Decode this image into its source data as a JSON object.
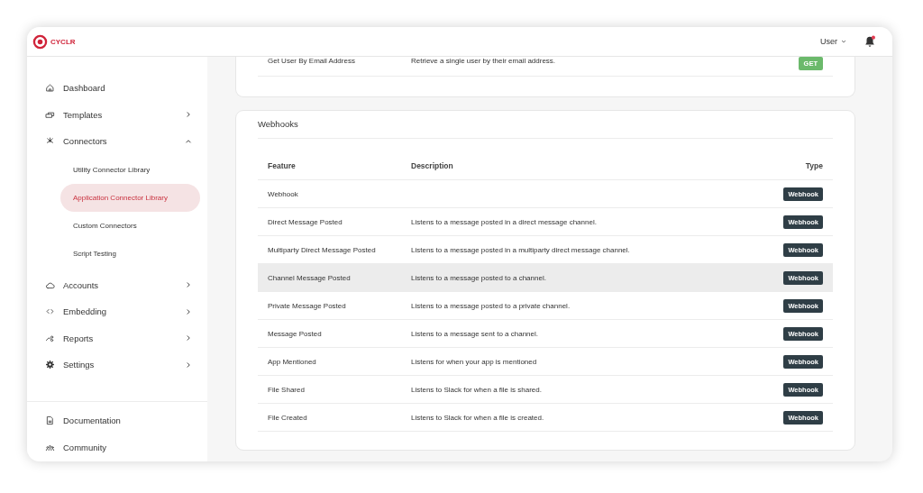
{
  "header": {
    "logo": "CYCLR",
    "user_menu": "User",
    "notifications": true
  },
  "sidebar": {
    "items": [
      {
        "label": "Dashboard"
      },
      {
        "label": "Templates",
        "expanded": false
      },
      {
        "label": "Connectors",
        "expanded": true,
        "children": [
          {
            "label": "Utility Connector Library",
            "selected": false
          },
          {
            "label": "Application Connector Library",
            "selected": true
          },
          {
            "label": "Custom Connectors",
            "selected": false
          },
          {
            "label": "Script Testing",
            "selected": false
          }
        ]
      },
      {
        "label": "Accounts",
        "expanded": false
      },
      {
        "label": "Embedding",
        "expanded": false
      },
      {
        "label": "Reports",
        "expanded": false
      },
      {
        "label": "Settings",
        "expanded": false
      }
    ],
    "footer_items": [
      {
        "label": "Documentation"
      },
      {
        "label": "Community"
      }
    ]
  },
  "actions_card": {
    "rows": [
      {
        "feature": "Get User By Email Address",
        "description": "Retrieve a single user by their email address.",
        "type": "GET",
        "kind": "get"
      }
    ]
  },
  "webhooks_card": {
    "title": "Webhooks",
    "columns": [
      "Feature",
      "Description",
      "Type"
    ],
    "rows": [
      {
        "feature": "Webhook",
        "description": "",
        "type": "Webhook",
        "kind": "webhook",
        "highlighted": false
      },
      {
        "feature": "Direct Message Posted",
        "description": "Listens to a message posted in a direct message channel.",
        "type": "Webhook",
        "kind": "webhook",
        "highlighted": false
      },
      {
        "feature": "Multiparty Direct Message Posted",
        "description": "Listens to a message posted in a multiparty direct message channel.",
        "type": "Webhook",
        "kind": "webhook",
        "highlighted": false
      },
      {
        "feature": "Channel Message Posted",
        "description": "Listens to a message posted to a channel.",
        "type": "Webhook",
        "kind": "webhook",
        "highlighted": true
      },
      {
        "feature": "Private Message Posted",
        "description": "Listens to a message posted to a private channel.",
        "type": "Webhook",
        "kind": "webhook",
        "highlighted": false
      },
      {
        "feature": "Message Posted",
        "description": "Listens to a message sent to a channel.",
        "type": "Webhook",
        "kind": "webhook",
        "highlighted": false
      },
      {
        "feature": "App Mentioned",
        "description": "Listens for when your app is mentioned",
        "type": "Webhook",
        "kind": "webhook",
        "highlighted": false
      },
      {
        "feature": "File Shared",
        "description": "Listens to Slack for when a file is shared.",
        "type": "Webhook",
        "kind": "webhook",
        "highlighted": false
      },
      {
        "feature": "File Created",
        "description": "Listens to Slack for when a file is created.",
        "type": "Webhook",
        "kind": "webhook",
        "highlighted": false
      }
    ]
  }
}
